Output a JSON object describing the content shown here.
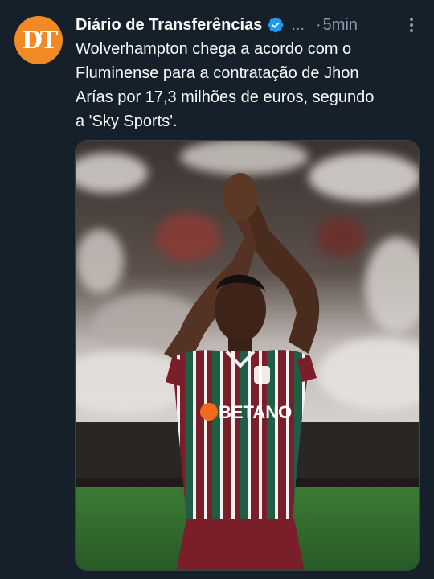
{
  "account": {
    "avatar_text": "DT",
    "name": "Diário de Transferências",
    "truncation": "...",
    "separator": "·",
    "time": "5min"
  },
  "tweet": {
    "lines": [
      "Wolverhampton chega a acordo com o",
      "Fluminense para a contratação de Jhon",
      "Arías por 17,3 milhões de euros, segundo",
      "a 'Sky Sports'."
    ]
  },
  "media": {
    "sponsor": "BETANO",
    "colors": {
      "grass": "#2f6a2e",
      "stand_dark": "#2a2624",
      "stand_light": "#cfcac6",
      "maroon": "#7a1e2a",
      "green_stripe": "#1f5e44",
      "skin": "#4a2c1f",
      "sponsor_orange": "#f26b1d"
    }
  },
  "colors": {
    "background": "#15202b",
    "text": "#f7f9f9",
    "muted": "#8b98a5",
    "verified": "#1d9bf0",
    "avatar": "#f08a24"
  }
}
